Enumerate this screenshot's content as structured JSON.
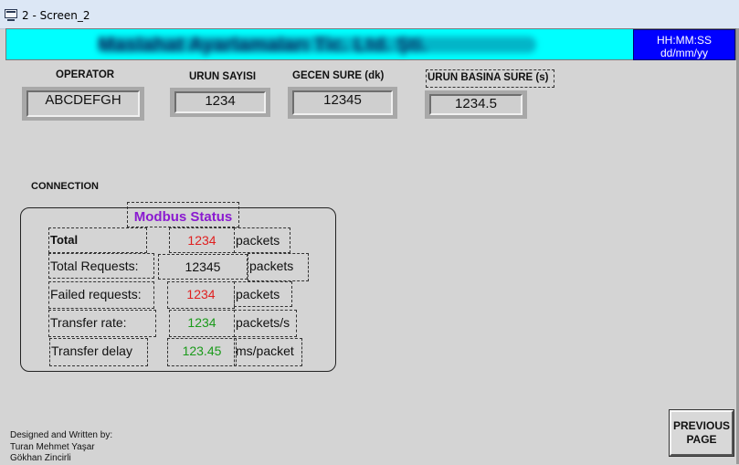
{
  "window": {
    "title": "2 - Screen_2"
  },
  "header": {
    "title": "Maslahat Ayarlamaları Tic. Ltd. Şti.",
    "clock_time": "HH:MM:SS",
    "clock_date": "dd/mm/yy",
    "colors": {
      "bar": "#00ffff",
      "clock_bg": "#0000ff"
    }
  },
  "fields": {
    "operator": {
      "label": "OPERATOR",
      "value": "ABCDEFGH"
    },
    "urun_sayisi": {
      "label": "URUN SAYISI",
      "value": "1234"
    },
    "gecen_sure": {
      "label": "GECEN SURE (dk)",
      "value": "12345"
    },
    "urun_basina_sure": {
      "label": "URUN BASINA SURE (s)",
      "value": "1234.5"
    }
  },
  "connection": {
    "label": "CONNECTION",
    "title": "Modbus Status",
    "rows": [
      {
        "label": "Total",
        "value": "1234",
        "unit": "packets",
        "color": "#e02020"
      },
      {
        "label": "Total Requests:",
        "value": "12345",
        "unit": "packets",
        "color": "#111111"
      },
      {
        "label": "Failed requests:",
        "value": "1234",
        "unit": "packets",
        "color": "#e02020"
      },
      {
        "label": "Transfer rate:",
        "value": "1234",
        "unit": "packets/s",
        "color": "#1a9a1a"
      },
      {
        "label": "Transfer delay",
        "value": "123.45",
        "unit": "ms/packet",
        "color": "#1a9a1a"
      }
    ]
  },
  "credits": {
    "line1": "Designed and Written by:",
    "line2": "Turan Mehmet Yaşar",
    "line3": "Gökhan Zincirli"
  },
  "buttons": {
    "previous_page_line1": "PREVIOUS",
    "previous_page_line2": "PAGE"
  }
}
